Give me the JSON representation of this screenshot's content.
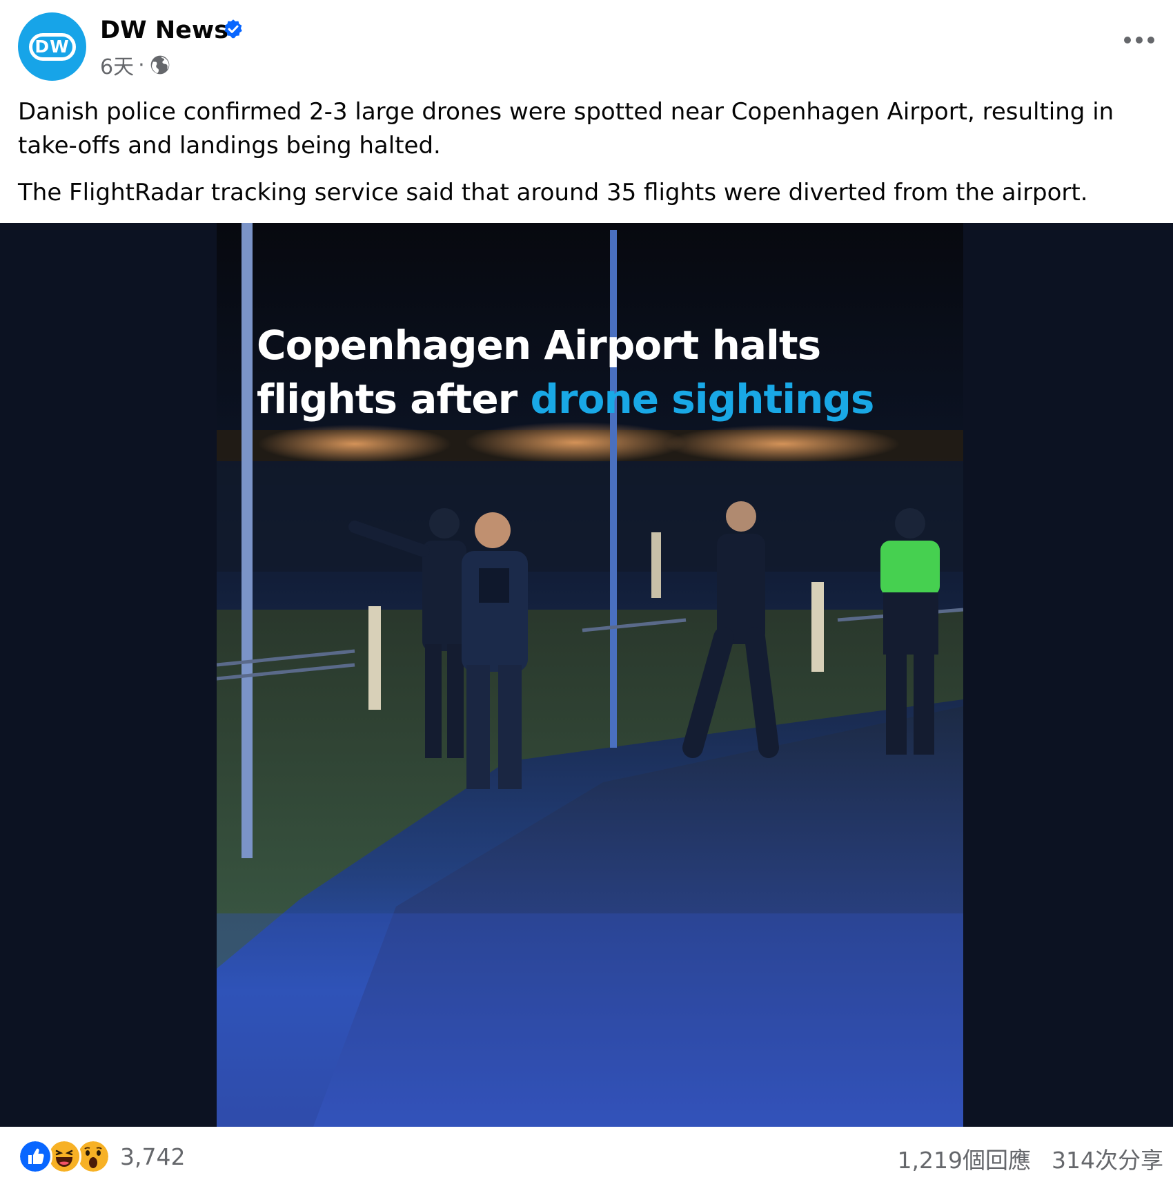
{
  "post": {
    "author": "DW News",
    "time": "6天",
    "separator": "·",
    "avatar_text": "DW",
    "paragraphs": [
      "Danish police confirmed 2-3 large drones were spotted near Copenhagen Airport, resulting in take-offs and landings being halted.",
      "The FlightRadar tracking service said that around 35 flights were diverted from the airport."
    ],
    "image": {
      "headline_part1": "Copenhagen Airport halts flights after ",
      "headline_highlight": "drone sightings"
    }
  },
  "footer": {
    "reaction_count": "3,742",
    "comments": "1,219個回應",
    "shares": "314次分享"
  },
  "icons": {
    "verified": "verified-badge-icon",
    "audience": "globe-icon",
    "more": "more-options-icon",
    "reactions": [
      "like-icon",
      "haha-icon",
      "wow-icon"
    ]
  },
  "colors": {
    "brand_blue": "#17a4e8",
    "verified_blue": "#0866ff",
    "headline_highlight": "#19a8e6",
    "secondary_text": "#65676b",
    "media_background": "#0c1222"
  }
}
